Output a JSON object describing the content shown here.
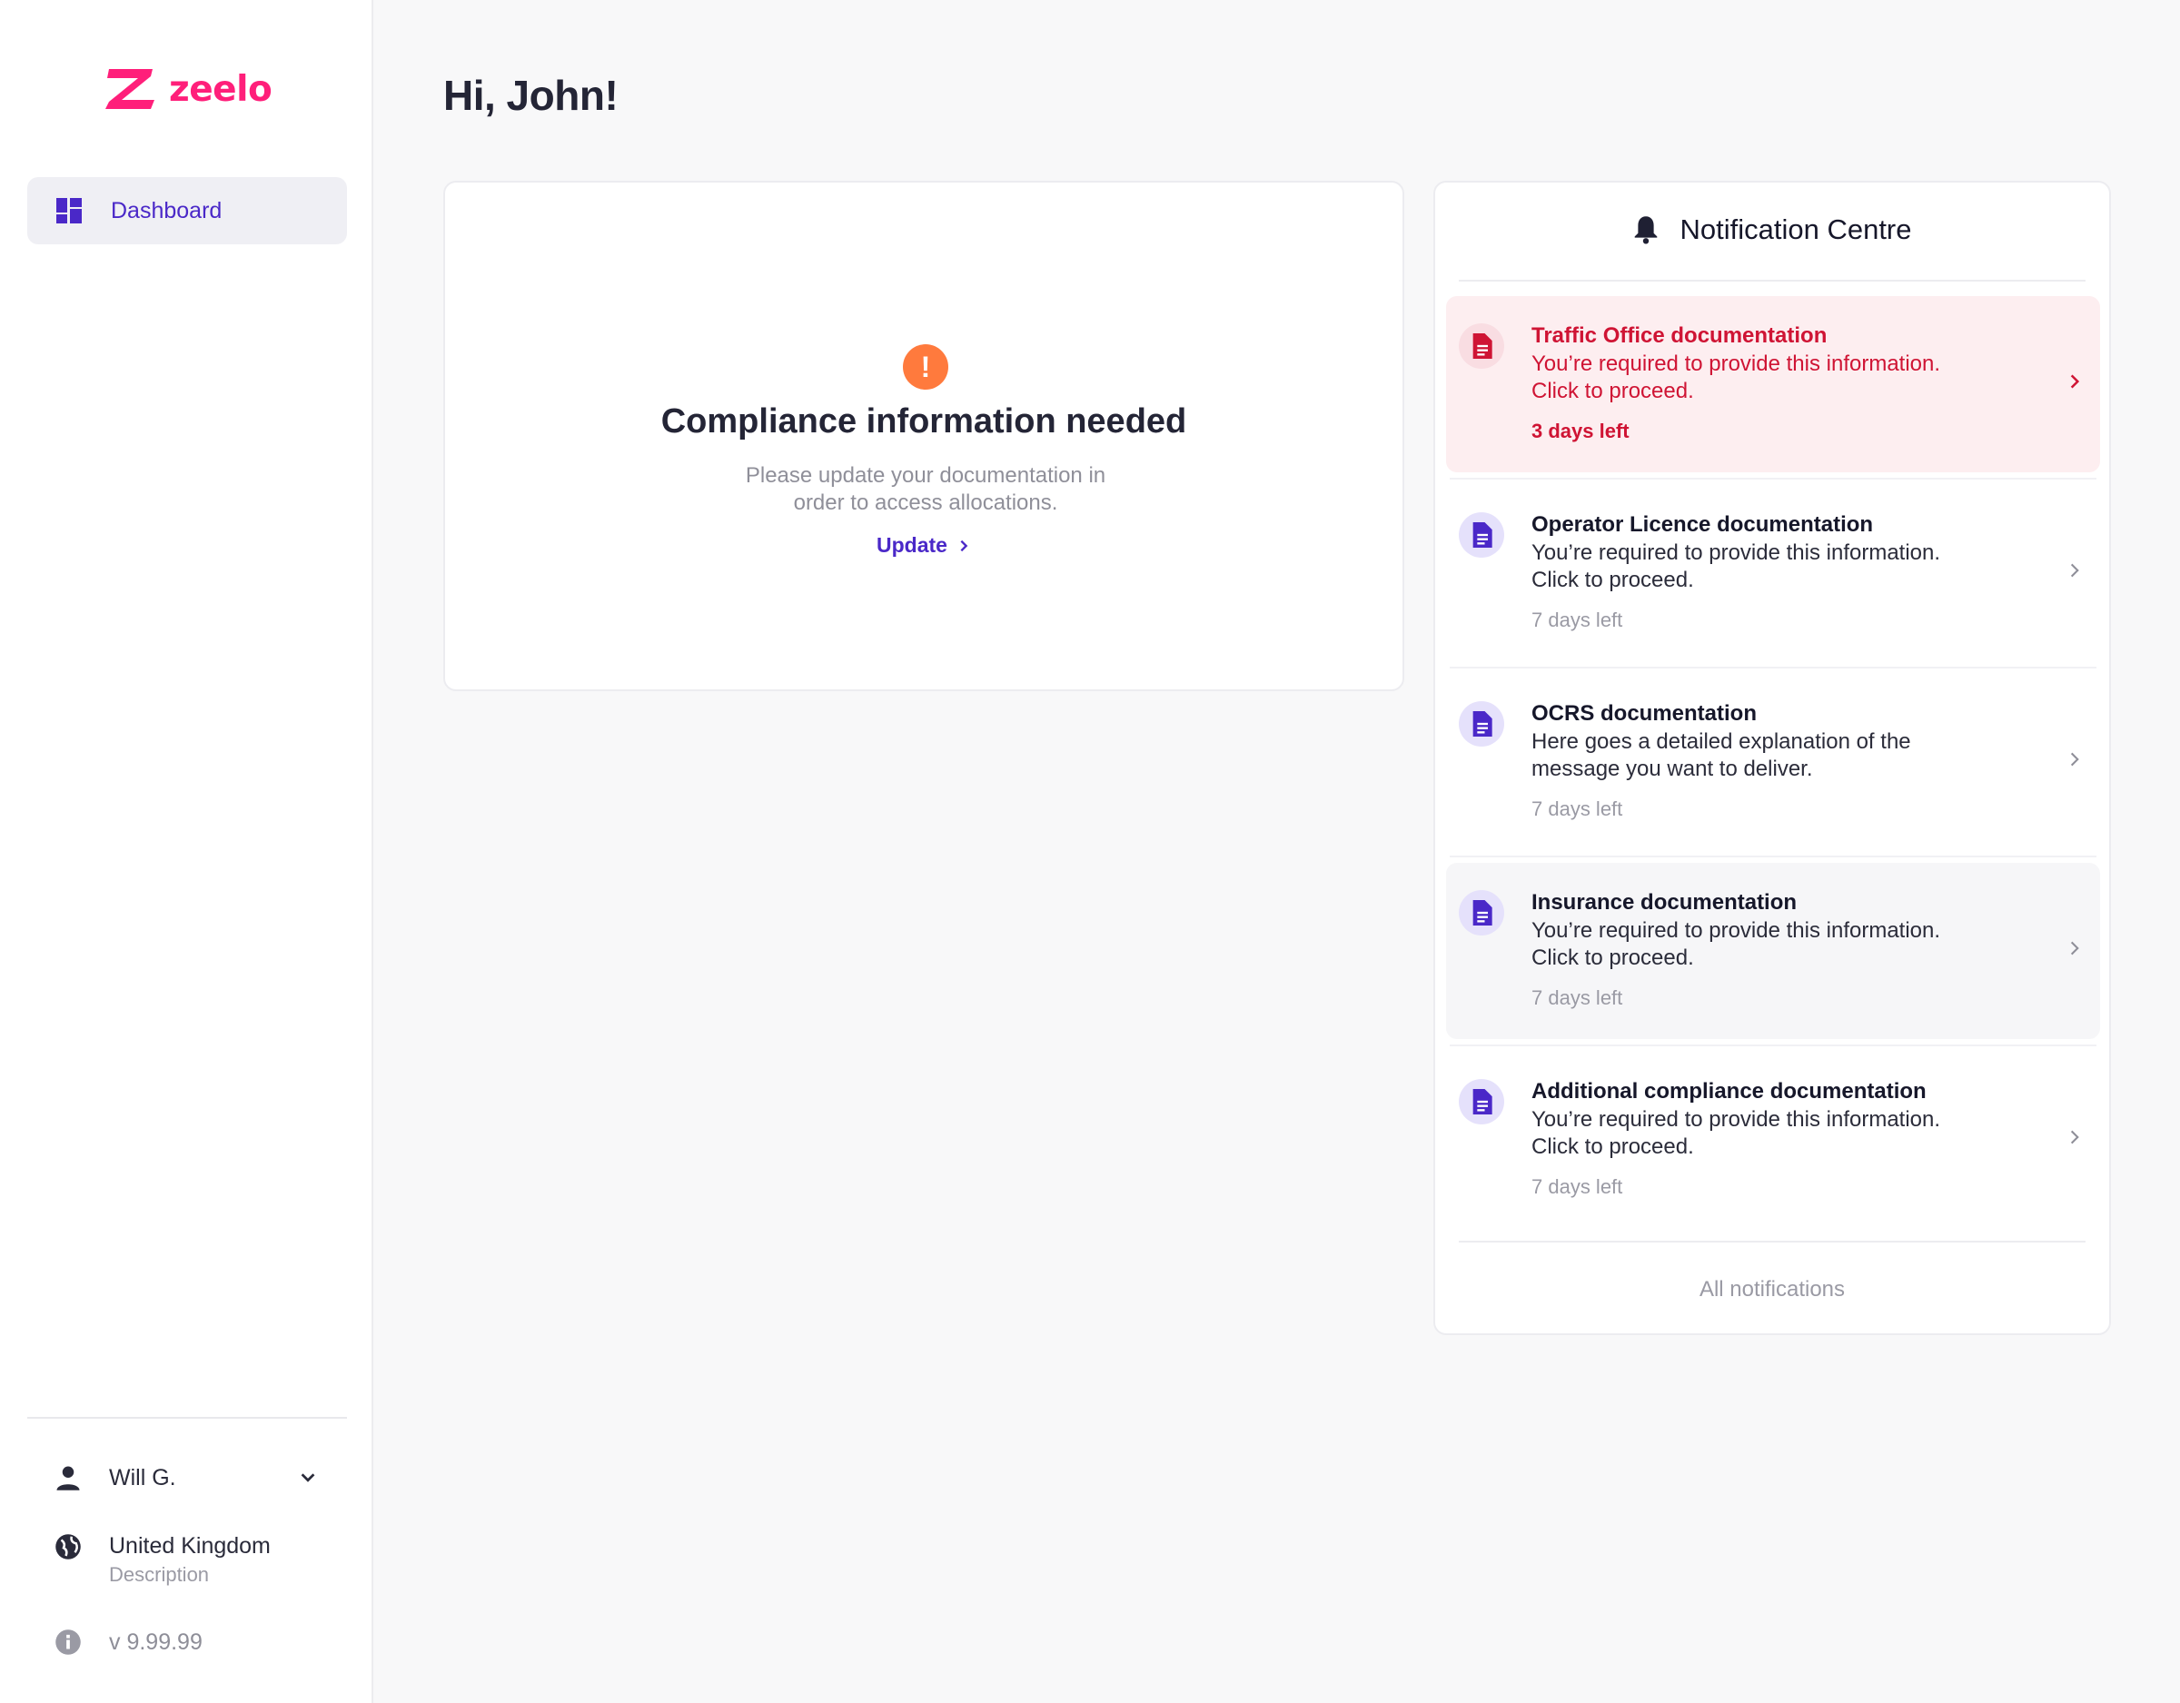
{
  "brand": {
    "name": "zeelo",
    "color": "#ff1f7a"
  },
  "sidebar": {
    "nav": [
      {
        "label": "Dashboard",
        "icon": "dashboard-icon",
        "active": true
      }
    ],
    "user": {
      "name": "Will G.",
      "icon": "person-icon"
    },
    "country": {
      "name": "United Kingdom",
      "description": "Description",
      "icon": "globe-icon"
    },
    "version": {
      "label": "v 9.99.99",
      "icon": "info-icon"
    }
  },
  "greeting": "Hi, John!",
  "compliance": {
    "icon": "!",
    "title": "Compliance information needed",
    "description": "Please update your documentation in order to access allocations.",
    "link_label": "Update"
  },
  "notifications": {
    "title": "Notification Centre",
    "items": [
      {
        "title": "Traffic Office documentation",
        "body": "You’re required to provide this information. Click to proceed.",
        "days": "3 days left",
        "status": "urgent"
      },
      {
        "title": "Operator Licence documentation",
        "body": "You’re required to provide this information. Click to proceed.",
        "days": "7 days left",
        "status": "normal"
      },
      {
        "title": "OCRS documentation",
        "body": "Here goes a detailed explanation of the message you want to deliver.",
        "days": "7 days left",
        "status": "normal"
      },
      {
        "title": "Insurance documentation",
        "body": "You’re required to provide this information. Click to proceed.",
        "days": "7 days left",
        "status": "hovered"
      },
      {
        "title": "Additional compliance documentation",
        "body": "You’re required to provide this information. Click to proceed.",
        "days": "7 days left",
        "status": "normal"
      }
    ],
    "all_label": "All notifications"
  },
  "colors": {
    "accent": "#4a28c8",
    "urgent": "#cf1434",
    "warning": "#ff7a3d"
  }
}
